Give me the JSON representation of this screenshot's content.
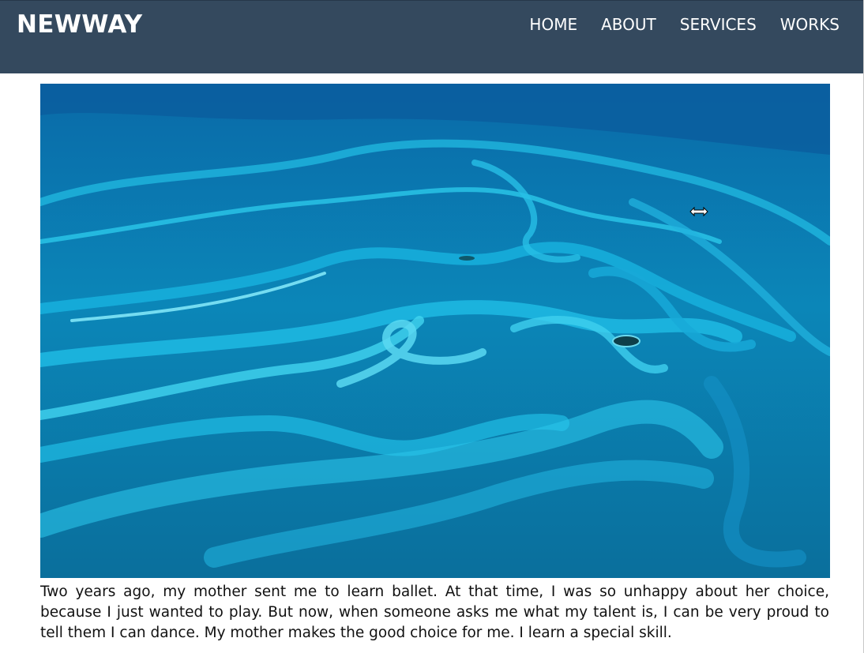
{
  "header": {
    "brand": "NEWWAY",
    "nav": [
      {
        "label": "HOME"
      },
      {
        "label": "ABOUT"
      },
      {
        "label": "SERVICES"
      },
      {
        "label": "WORKS"
      }
    ]
  },
  "hero": {
    "image_subject": "aerial ocean shoals",
    "colors": {
      "deep": "#0a5a8c",
      "mid": "#0b8fbf",
      "shallow": "#20c4e8",
      "light": "#6ee0f5"
    }
  },
  "cursor": {
    "icon": "horizontal-resize-cursor-icon"
  },
  "content": {
    "paragraph": "Two years ago, my mother sent me to learn ballet. At that time, I was so unhappy about her choice, because I just wanted to play. But now, when someone asks me what my talent is, I can be very proud to tell them I can dance. My mother makes the good choice for me. I learn a special skill."
  }
}
